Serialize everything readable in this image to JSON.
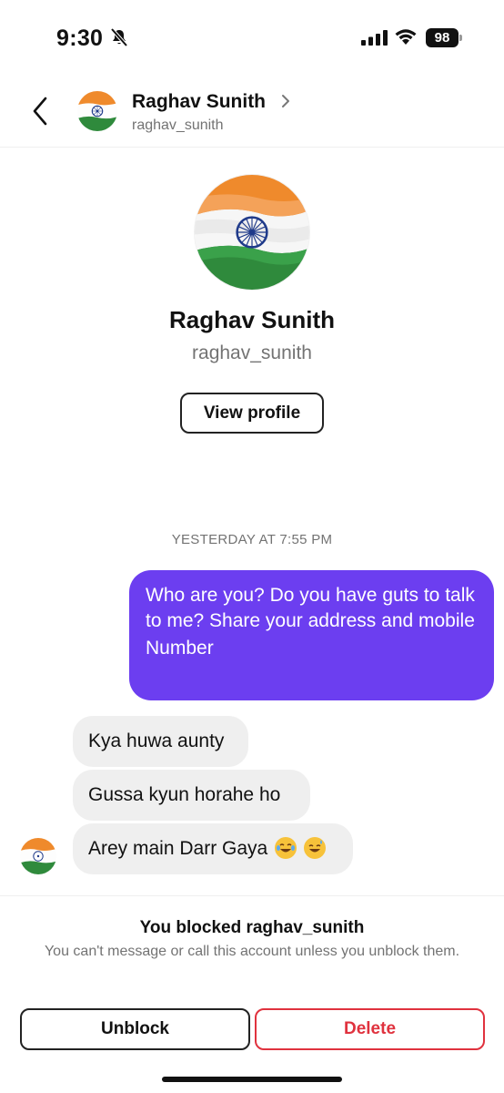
{
  "status_bar": {
    "time": "9:30",
    "battery_level": "98",
    "icons": [
      "bell-off-icon",
      "signal-icon",
      "wifi-icon",
      "battery-icon"
    ]
  },
  "header": {
    "back_icon": "chevron-left-icon",
    "name": "Raghav Sunith",
    "username": "raghav_sunith",
    "chevron_icon": "chevron-right-icon"
  },
  "profile": {
    "name": "Raghav Sunith",
    "username": "raghav_sunith",
    "view_profile_label": "View profile",
    "avatar": "india-flag-avatar"
  },
  "conversation": {
    "timestamp": "YESTERDAY AT 7:55 PM",
    "outgoing": {
      "text_line1": "Who are you? Do you have guts to talk to me? Share your address and mobile",
      "text_line2": "Number"
    },
    "incoming": [
      {
        "text": "Kya huwa aunty"
      },
      {
        "text": "Gussa kyun horahe ho"
      },
      {
        "text": "Arey main Darr Gaya",
        "emojis": [
          "laughing-tears-emoji",
          "sweat-smile-emoji"
        ]
      }
    ]
  },
  "blocked": {
    "title": "You blocked raghav_sunith",
    "description": "You can't message or call this account unless you unblock them.",
    "unblock_label": "Unblock",
    "delete_label": "Delete"
  },
  "colors": {
    "outgoing_bubble": "#6c3ef0",
    "incoming_bubble": "#efefef",
    "delete_red": "#e0323e",
    "secondary_text": "#737373"
  }
}
